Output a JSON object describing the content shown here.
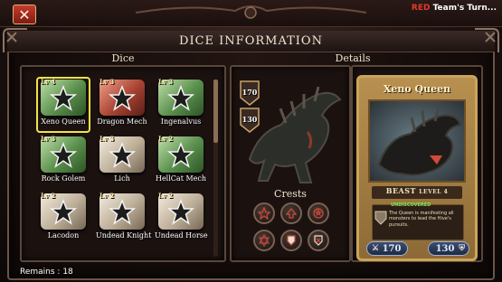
{
  "topbar": {
    "turn_team": "RED",
    "turn_text": " Team's Turn..."
  },
  "title": "DICE INFORMATION",
  "dice_panel": {
    "header": "Dice",
    "dice": [
      {
        "level": "Lv 4",
        "name": "Xeno Queen",
        "color": "green",
        "selected": true
      },
      {
        "level": "Lv 3",
        "name": "Dragon Mech",
        "color": "red",
        "selected": false
      },
      {
        "level": "Lv 3",
        "name": "Ingenalvus",
        "color": "green",
        "selected": false
      },
      {
        "level": "Lv 3",
        "name": "Rock Golem",
        "color": "green",
        "selected": false
      },
      {
        "level": "Lv 3",
        "name": "Lich",
        "color": "white",
        "selected": false
      },
      {
        "level": "Lv 2",
        "name": "HellCat Mech",
        "color": "green",
        "selected": false
      },
      {
        "level": "Lv 2",
        "name": "Lacodon",
        "color": "white",
        "selected": false
      },
      {
        "level": "Lv 2",
        "name": "Undead Knight",
        "color": "white",
        "selected": false
      },
      {
        "level": "Lv 2",
        "name": "Undead Horse",
        "color": "white",
        "selected": false
      }
    ],
    "remains": "Remains : 18"
  },
  "details_panel": {
    "header": "Details",
    "attack": "170",
    "defense": "130",
    "crests_label": "Crests"
  },
  "card": {
    "name": "Xeno Queen",
    "type": "BEAST",
    "level": "LEVEL 4",
    "tag": "UNDISCOVERED",
    "description": "The Queen is manifesting all monsters to lead the Hive's pursuits.",
    "attack": "170",
    "defense": "130"
  },
  "colors": {
    "selected_outline": "#f4e24a",
    "card_border": "#caa55a",
    "team_red": "#e33a2c"
  }
}
